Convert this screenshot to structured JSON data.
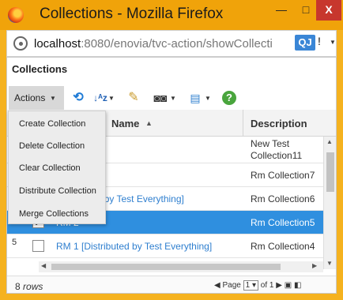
{
  "window": {
    "title": "Collections - Mozilla Firefox",
    "min": "—",
    "max": "□",
    "close": "X"
  },
  "urlbar": {
    "host": "localhost",
    "rest": ":8080/enovia/tvc-action/showCollecti",
    "addon": "QJ",
    "addon_suffix": "!"
  },
  "page": {
    "title": "Collections"
  },
  "toolbar": {
    "actions_label": "Actions"
  },
  "menu": {
    "items": [
      "Create Collection",
      "Delete Collection",
      "Clear Collection",
      "Distribute Collection",
      "Merge Collections"
    ]
  },
  "grid": {
    "headers": {
      "name": "Name",
      "description": "Description"
    },
    "rows": [
      {
        "num": "",
        "checked": false,
        "name": "",
        "desc": "New Test Collection11"
      },
      {
        "num": "",
        "checked": false,
        "name": "",
        "desc": "Rm Collection7"
      },
      {
        "num": "",
        "checked": false,
        "name": "Distributed by Test Everything]",
        "desc": "Rm Collection6"
      },
      {
        "num": "",
        "checked": true,
        "name": "RM 2",
        "desc": "Rm Collection5",
        "selected": true
      },
      {
        "num": "5",
        "checked": false,
        "name": "RM 1 [Distributed by Test Everything]",
        "desc": "Rm Collection4"
      }
    ]
  },
  "footer": {
    "rows_count": "8",
    "rows_word": "rows",
    "page_label": "Page",
    "page_value": "1",
    "of_label": "of",
    "total_pages": "1"
  }
}
